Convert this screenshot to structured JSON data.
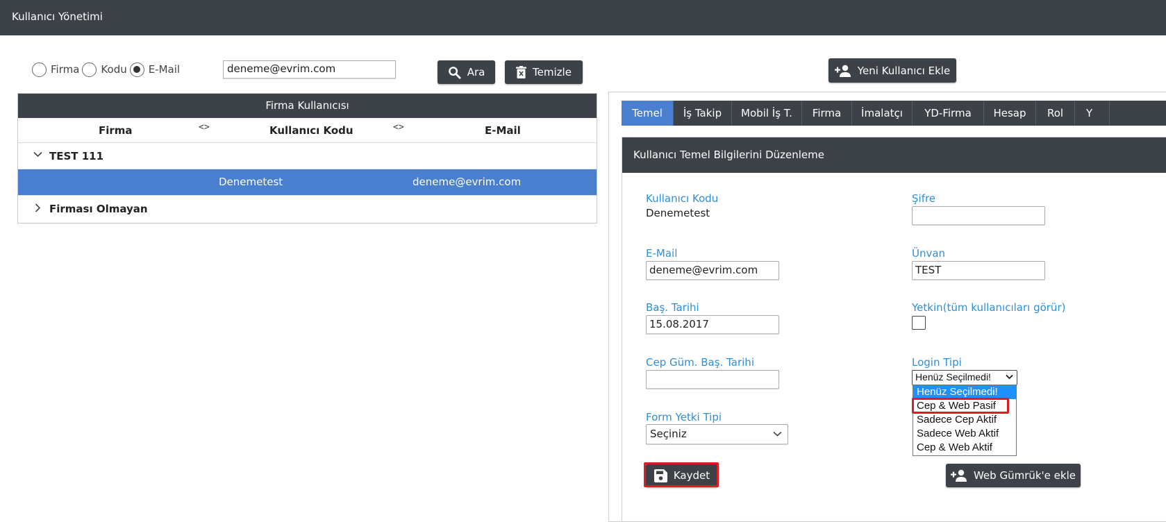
{
  "app": {
    "title": "Kullanıcı Yönetimi"
  },
  "search": {
    "radios": [
      {
        "label": "Firma",
        "checked": false
      },
      {
        "label": "Kodu",
        "checked": false
      },
      {
        "label": "E-Mail",
        "checked": true
      }
    ],
    "value": "deneme@evrim.com",
    "search_button": "Ara",
    "clear_button": "Temizle",
    "add_user_button": "Yeni Kullanıcı Ekle"
  },
  "users_panel": {
    "title": "Firma Kullanıcısı",
    "columns": [
      "Firma",
      "Kullanıcı Kodu",
      "E-Mail"
    ],
    "sort_glyph": "<>",
    "groups": [
      {
        "name": "TEST 111",
        "expanded": true
      },
      {
        "name": "Firması Olmayan",
        "expanded": false
      }
    ],
    "selected_row": {
      "code": "Denemetest",
      "email": "deneme@evrim.com"
    }
  },
  "tabs": [
    "Temel",
    "İş Takip",
    "Mobil İş T.",
    "Firma",
    "İmalatçı",
    "YD-Firma",
    "Hesap",
    "Rol",
    "Y"
  ],
  "form": {
    "title": "Kullanıcı Temel Bilgilerini Düzenleme",
    "user_code_label": "Kullanıcı Kodu",
    "user_code_value": "Denemetest",
    "password_label": "Şifre",
    "password_value": "",
    "email_label": "E-Mail",
    "email_value": "deneme@evrim.com",
    "title_label": "Ünvan",
    "title_value": "TEST",
    "start_date_label": "Baş. Tarihi",
    "start_date_value": "15.08.2017",
    "authority_label": "Yetkin(tüm kullanıcıları görür)",
    "authority_checked": false,
    "mobile_start_label": "Cep Güm. Baş. Tarihi",
    "mobile_start_value": "",
    "login_type_label": "Login Tipi",
    "login_type_value": "Henüz Seçilmedi!",
    "login_type_options": [
      "Henüz Seçilmedi!",
      "Cep & Web Pasif",
      "Sadece Cep Aktif",
      "Sadece Web Aktif",
      "Cep & Web Aktif"
    ],
    "form_authority_label": "Form Yetki Tipi",
    "form_authority_value": "Seçiniz",
    "save_button": "Kaydet",
    "web_customs_button": "Web Gümrük'e ekle"
  },
  "colors": {
    "dark": "#3c4247",
    "accent": "#4a7fcf",
    "label": "#2d8fd8",
    "highlight_outline": "#e01b24"
  }
}
